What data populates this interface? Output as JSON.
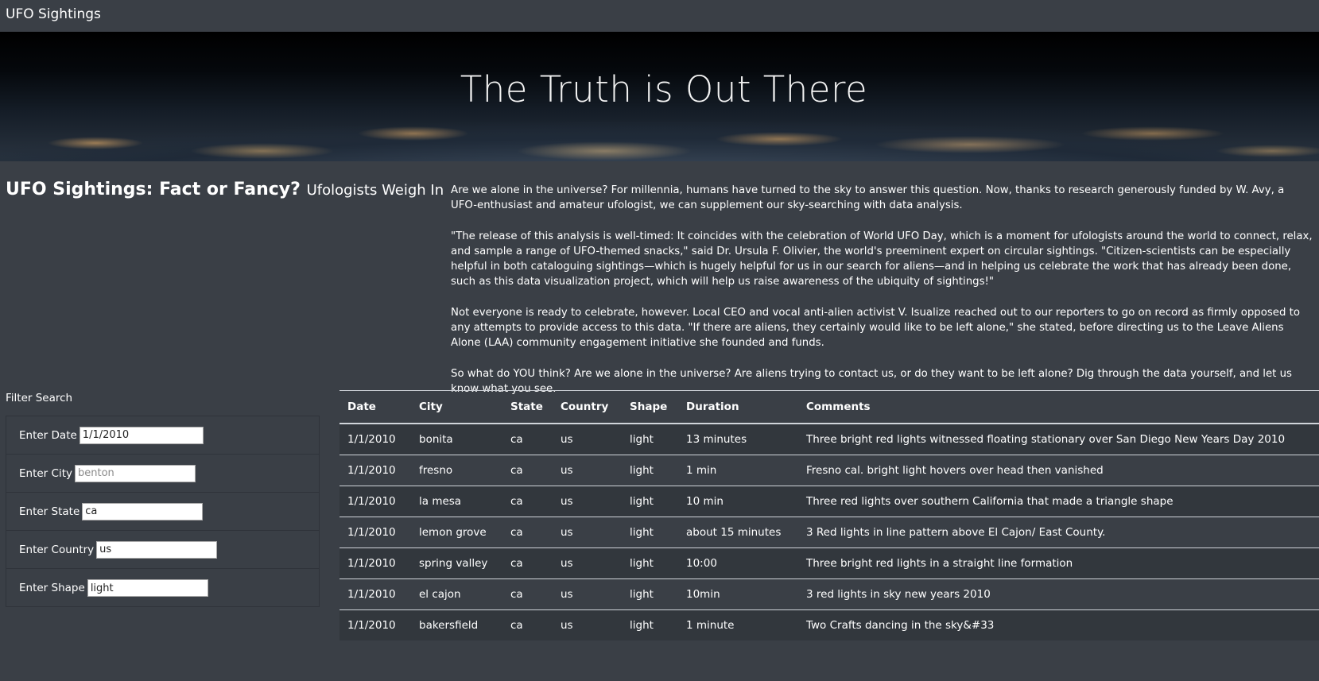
{
  "navbar": {
    "brand": "UFO Sightings"
  },
  "hero": {
    "title": "The Truth is Out There"
  },
  "intro": {
    "heading": "UFO Sightings: Fact or Fancy?",
    "subheading": "Ufologists Weigh In"
  },
  "article": {
    "paragraphs": [
      "Are we alone in the universe? For millennia, humans have turned to the sky to answer this question. Now, thanks to research generously funded by W. Avy, a UFO-enthusiast and amateur ufologist, we can supplement our sky-searching with data analysis.",
      "\"The release of this analysis is well-timed: It coincides with the celebration of World UFO Day, which is a moment for ufologists around the world to connect, relax, and sample a range of UFO-themed snacks,\" said Dr. Ursula F. Olivier, the world's preeminent expert on circular sightings. \"Citizen-scientists can be especially helpful in both cataloguing sightings—which is hugely helpful for us in our search for aliens—and in helping us celebrate the work that has already been done, such as this data visualization project, which will help us raise awareness of the ubiquity of sightings!\"",
      "Not everyone is ready to celebrate, however. Local CEO and vocal anti-alien activist V. Isualize reached out to our reporters to go on record as firmly opposed to any attempts to provide access to this data. \"If there are aliens, they certainly would like to be left alone,\" she stated, before directing us to the Leave Aliens Alone (LAA) community engagement initiative she founded and funds.",
      "So what do YOU think? Are we alone in the universe? Are aliens trying to contact us, or do they want to be left alone? Dig through the data yourself, and let us know what you see."
    ]
  },
  "filters": {
    "title": "Filter Search",
    "date": {
      "label": "Enter Date",
      "value": "1/1/2010",
      "placeholder": ""
    },
    "city": {
      "label": "Enter City",
      "value": "",
      "placeholder": "benton"
    },
    "state": {
      "label": "Enter State",
      "value": "ca",
      "placeholder": ""
    },
    "country": {
      "label": "Enter Country",
      "value": "us",
      "placeholder": ""
    },
    "shape": {
      "label": "Enter Shape",
      "value": "light",
      "placeholder": ""
    }
  },
  "table": {
    "headers": [
      "Date",
      "City",
      "State",
      "Country",
      "Shape",
      "Duration",
      "Comments"
    ],
    "rows": [
      [
        "1/1/2010",
        "bonita",
        "ca",
        "us",
        "light",
        "13 minutes",
        "Three bright red lights witnessed floating stationary over San Diego New Years Day 2010"
      ],
      [
        "1/1/2010",
        "fresno",
        "ca",
        "us",
        "light",
        "1 min",
        "Fresno cal. bright light hovers over head then vanished"
      ],
      [
        "1/1/2010",
        "la mesa",
        "ca",
        "us",
        "light",
        "10 min",
        "Three red lights over southern California that made a triangle shape"
      ],
      [
        "1/1/2010",
        "lemon grove",
        "ca",
        "us",
        "light",
        "about 15 minutes",
        "3 Red lights in line pattern above El Cajon/ East County."
      ],
      [
        "1/1/2010",
        "spring valley",
        "ca",
        "us",
        "light",
        "10:00",
        "Three bright red lights in a straight line formation"
      ],
      [
        "1/1/2010",
        "el cajon",
        "ca",
        "us",
        "light",
        "10min",
        "3 red lights in sky new years 2010"
      ],
      [
        "1/1/2010",
        "bakersfield",
        "ca",
        "us",
        "light",
        "1 minute",
        "Two Crafts dancing in the sky&#33"
      ]
    ]
  }
}
